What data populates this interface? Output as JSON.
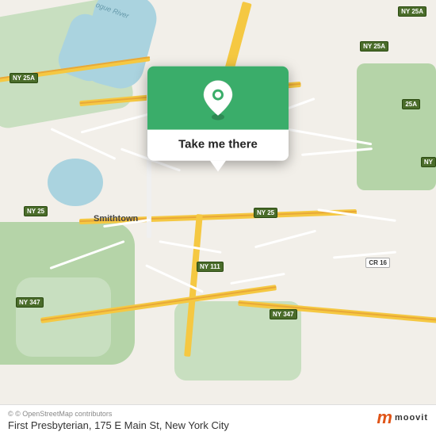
{
  "map": {
    "attribution": "© OpenStreetMap contributors",
    "location_label": "First Presbyterian, 175 E Main St, New York City"
  },
  "popup": {
    "button_label": "Take me there"
  },
  "footer": {
    "credit": "© OpenStreetMap contributors",
    "title": "First Presbyterian, 175 E Main St, New York City"
  },
  "branding": {
    "logo_letter": "m",
    "logo_text": "moovit"
  },
  "road_labels": {
    "ny25a_nw": "NY 25A",
    "ny25a_ne": "NY 25A",
    "ny25a_e": "NY 25A",
    "ny25_w": "NY 25",
    "ny25_e": "NY 25",
    "ny111": "NY 111",
    "ny347_sw": "NY 347",
    "ny347_se": "NY 347",
    "cr16": "CR 16",
    "place_smithtown": "Smithtown"
  }
}
